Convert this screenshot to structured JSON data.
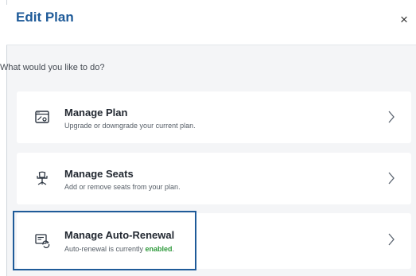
{
  "dialog": {
    "title": "Edit Plan",
    "close_label": "×",
    "prompt": "What would you like to do?"
  },
  "options": [
    {
      "title": "Manage Plan",
      "description": "Upgrade or downgrade your current plan.",
      "icon": "plan-window-icon"
    },
    {
      "title": "Manage Seats",
      "description": "Add or remove seats from your plan.",
      "icon": "office-chair-icon"
    },
    {
      "title": "Manage Auto-Renewal",
      "description_prefix": "Auto-renewal is currently ",
      "description_status": "enabled",
      "description_suffix": ".",
      "icon": "auto-renewal-icon",
      "highlighted": true
    }
  ],
  "colors": {
    "title": "#1f5b99",
    "enabled": "#2e9a3b",
    "highlight_border": "#1f5b99",
    "panel_background": "#f4f5f7"
  }
}
